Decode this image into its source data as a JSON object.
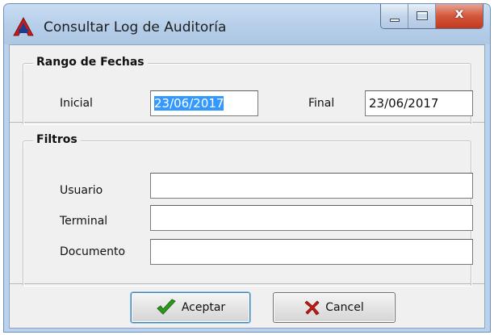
{
  "window": {
    "title": "Consultar Log de Auditoría",
    "close_label": "x"
  },
  "dates": {
    "legend": "Rango de Fechas",
    "initial_label": "Inicial",
    "initial_value": "23/06/2017",
    "final_label": "Final",
    "final_value": "23/06/2017"
  },
  "filters": {
    "legend": "Filtros",
    "user_label": "Usuario",
    "user_value": "",
    "terminal_label": "Terminal",
    "terminal_value": "",
    "document_label": "Documento",
    "document_value": ""
  },
  "actions": {
    "accept_label": "Aceptar",
    "cancel_label": "Cancel"
  },
  "icons": {
    "app": "app-logo-icon",
    "accept": "checkmark-icon",
    "cancel": "x-mark-icon"
  },
  "colors": {
    "selection": "#3399ff",
    "accept_icon": "#2e9a1c",
    "cancel_icon": "#c41b12",
    "close_button": "#c4381c"
  }
}
